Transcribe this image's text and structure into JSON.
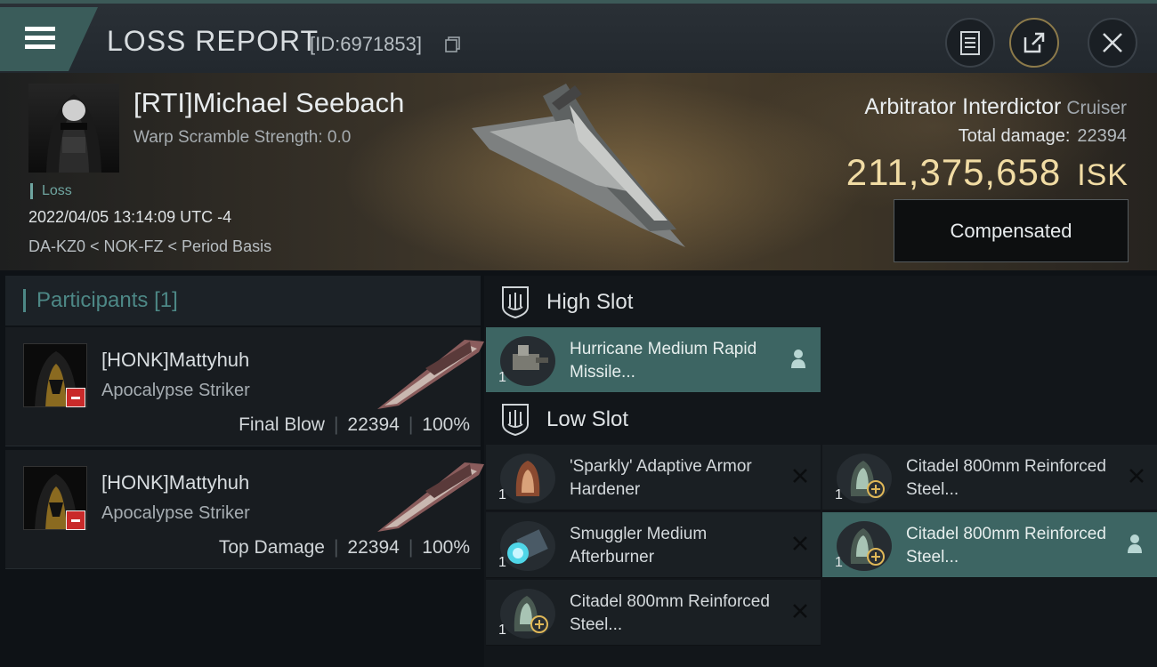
{
  "header": {
    "title": "LOSS REPORT",
    "report_id": "[ID:6971853]",
    "icons": [
      "menu-icon",
      "copy-icon",
      "clipboard-icon",
      "share-icon",
      "close-icon"
    ]
  },
  "victim": {
    "name": "[RTI]Michael Seebach",
    "warp_scramble": "Warp Scramble Strength: 0.0",
    "status": "Loss",
    "datetime": "2022/04/05 13:14:09 UTC -4",
    "location": "DA-KZ0 < NOK-FZ < Period Basis",
    "ship_name": "Arbitrator Interdictor",
    "ship_class": "Cruiser",
    "total_damage_label": "Total damage:",
    "total_damage": "22394",
    "isk_value": "211,375,658",
    "isk_unit": "ISK",
    "compensate_label": "Compensated"
  },
  "participants": {
    "label": "Participants",
    "count": "[1]",
    "rows": [
      {
        "name": "[HONK]Mattyhuh",
        "ship": "Apocalypse Striker",
        "role": "Final Blow",
        "damage": "22394",
        "percent": "100%"
      },
      {
        "name": "[HONK]Mattyhuh",
        "ship": "Apocalypse Striker",
        "role": "Top Damage",
        "damage": "22394",
        "percent": "100%"
      }
    ]
  },
  "slots": {
    "high": {
      "label": "High Slot",
      "modules": [
        {
          "name": "Hurricane Medium Rapid Missile...",
          "qty": "1"
        }
      ]
    },
    "low": {
      "label": "Low Slot",
      "modules": [
        {
          "name": "'Sparkly' Adaptive Armor Hardener",
          "qty": "1"
        },
        {
          "name": "Citadel 800mm Reinforced Steel...",
          "qty": "1"
        },
        {
          "name": "Smuggler Medium Afterburner",
          "qty": "1"
        },
        {
          "name": "Citadel 800mm Reinforced Steel...",
          "qty": "1"
        },
        {
          "name": "Citadel 800mm Reinforced Steel...",
          "qty": "1"
        }
      ]
    }
  },
  "colors": {
    "accent": "#3d6563",
    "isk": "#f1dca4",
    "loss": "#6fa5a0",
    "badge": "#c92a2a"
  }
}
